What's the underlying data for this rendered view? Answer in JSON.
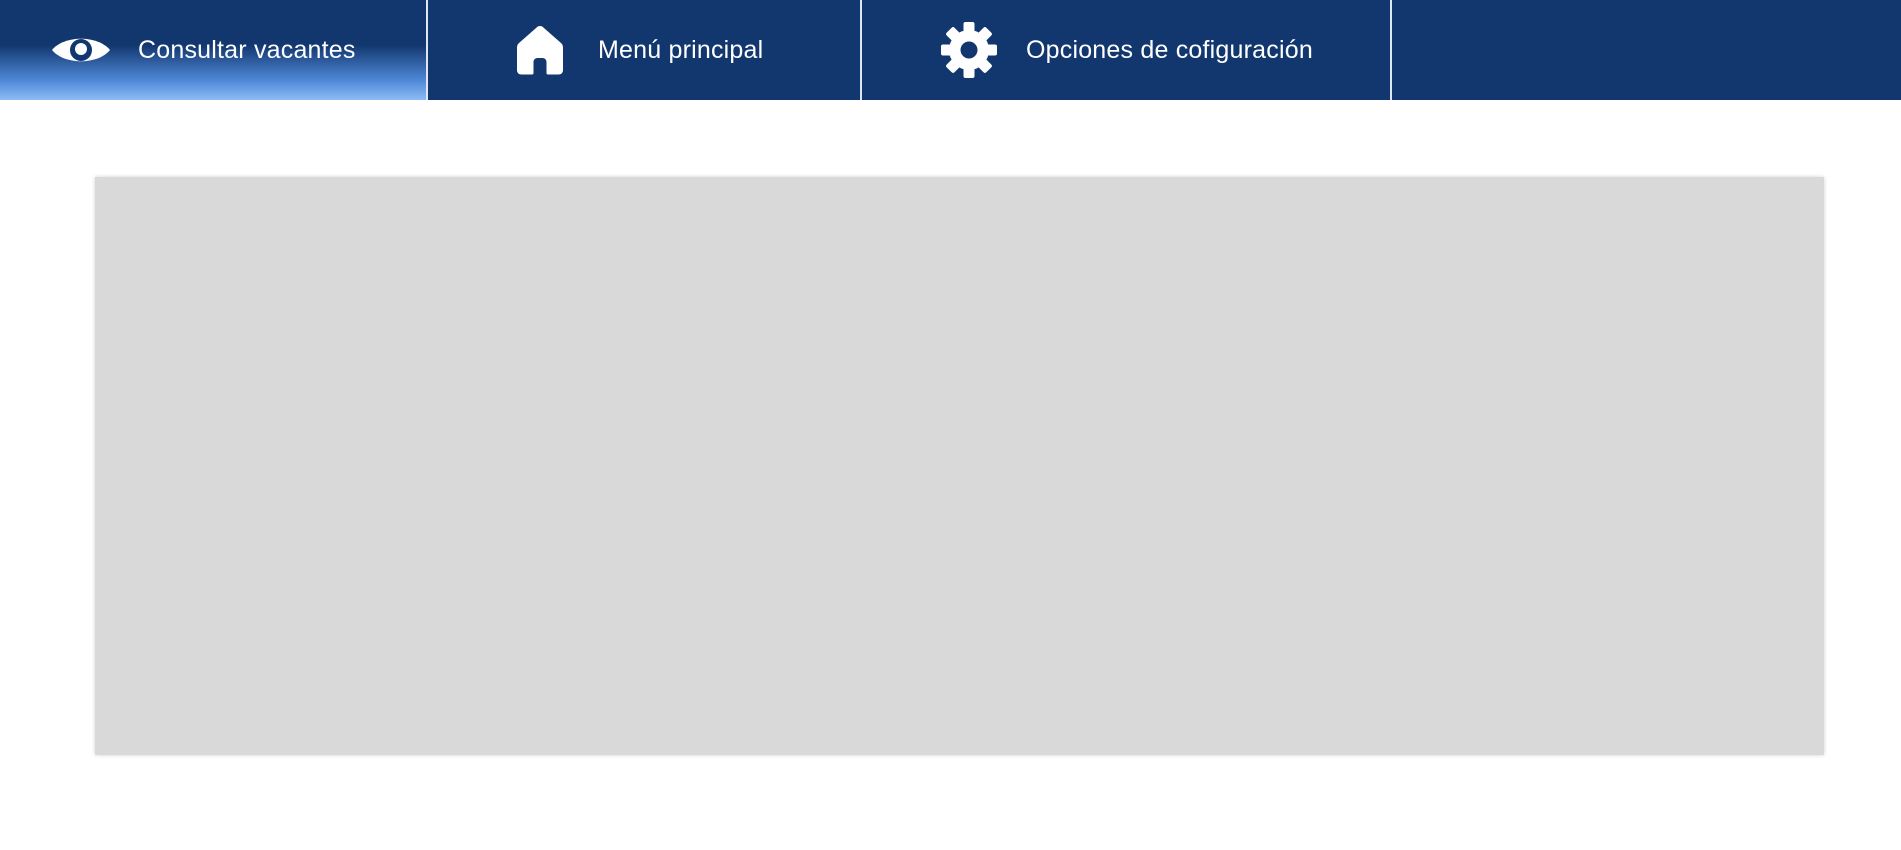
{
  "nav": {
    "tabs": [
      {
        "label": "Consultar vacantes",
        "icon": "eye-icon",
        "active": true
      },
      {
        "label": "Menú principal",
        "icon": "home-icon",
        "active": false
      },
      {
        "label": "Opciones de cofiguración",
        "icon": "gear-icon",
        "active": false
      }
    ]
  },
  "colors": {
    "navbar": "#12376f",
    "active_tab_gradient_end": "#8cbcf7",
    "panel": "#d9d9d9",
    "divider": "#dfe6f0",
    "text": "#ffffff"
  }
}
